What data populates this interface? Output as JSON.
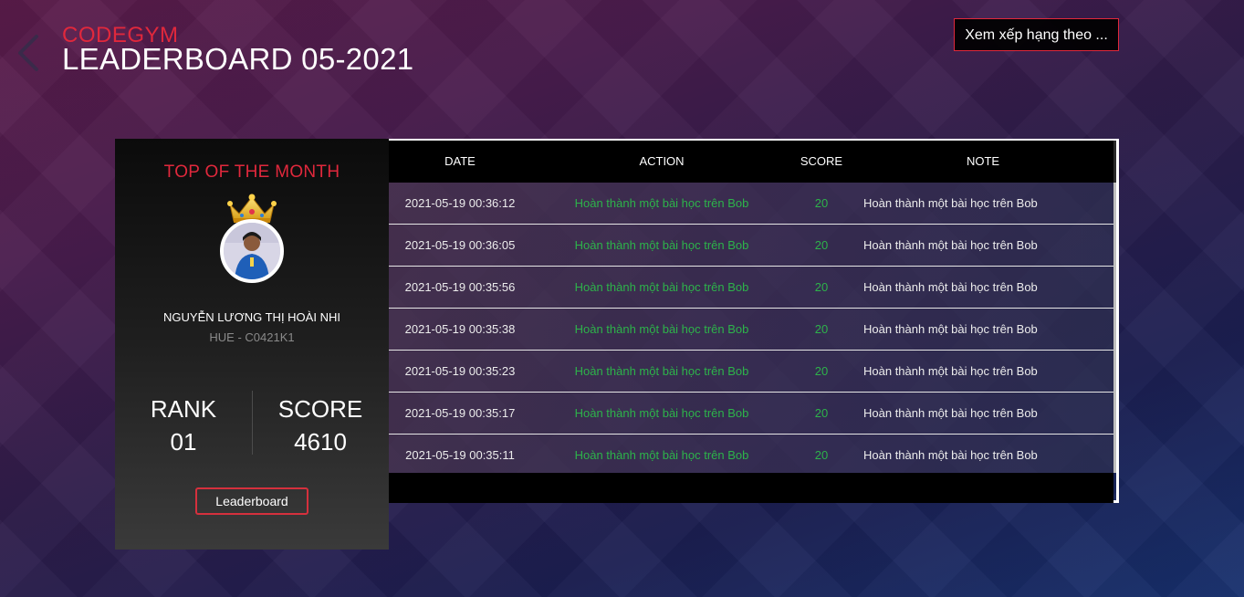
{
  "header": {
    "brand": "CODEGYM",
    "title": "LEADERBOARD 05-2021",
    "rank_by_button": "Xem xếp hạng theo ...",
    "back_icon": "chevron-left-icon"
  },
  "colors": {
    "accent_red": "#e0283c",
    "action_green": "#2db34a",
    "card_dark": "#111111"
  },
  "profile": {
    "heading": "TOP OF THE MONTH",
    "crown_icon": "crown-icon",
    "name": "NGUYỄN LƯƠNG THỊ HOÀI NHI",
    "class": "HUE - C0421K1",
    "rank_label": "RANK",
    "rank_value": "01",
    "score_label": "SCORE",
    "score_value": "4610",
    "leaderboard_button": "Leaderboard"
  },
  "table": {
    "columns": [
      "DATE",
      "ACTION",
      "SCORE",
      "NOTE"
    ],
    "rows": [
      {
        "date": "2021-05-19 00:36:12",
        "action": "Hoàn thành một bài học trên Bob",
        "score": "20",
        "note": "Hoàn thành một bài học trên Bob"
      },
      {
        "date": "2021-05-19 00:36:05",
        "action": "Hoàn thành một bài học trên Bob",
        "score": "20",
        "note": "Hoàn thành một bài học trên Bob"
      },
      {
        "date": "2021-05-19 00:35:56",
        "action": "Hoàn thành một bài học trên Bob",
        "score": "20",
        "note": "Hoàn thành một bài học trên Bob"
      },
      {
        "date": "2021-05-19 00:35:38",
        "action": "Hoàn thành một bài học trên Bob",
        "score": "20",
        "note": "Hoàn thành một bài học trên Bob"
      },
      {
        "date": "2021-05-19 00:35:23",
        "action": "Hoàn thành một bài học trên Bob",
        "score": "20",
        "note": "Hoàn thành một bài học trên Bob"
      },
      {
        "date": "2021-05-19 00:35:17",
        "action": "Hoàn thành một bài học trên Bob",
        "score": "20",
        "note": "Hoàn thành một bài học trên Bob"
      },
      {
        "date": "2021-05-19 00:35:11",
        "action": "Hoàn thành một bài học trên Bob",
        "score": "20",
        "note": "Hoàn thành một bài học trên Bob"
      }
    ]
  }
}
